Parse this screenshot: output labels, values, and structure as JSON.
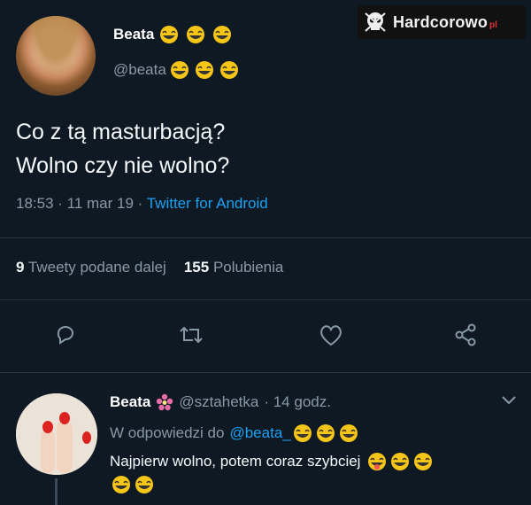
{
  "watermark": {
    "brand": "Hardcorowo",
    "tld": "pl"
  },
  "tweet": {
    "display_name": "Beata",
    "handle": "@beata",
    "text_line1": "Co z tą masturbacją?",
    "text_line2": "Wolno czy nie wolno?",
    "time": "18:53 · 11 mar 19 · ",
    "source": "Twitter for Android",
    "retweets_count": "9",
    "retweets_label": "Tweety podane dalej",
    "likes_count": "155",
    "likes_label": "Polubienia"
  },
  "actions": [
    "reply-icon",
    "retweet-icon",
    "like-icon",
    "share-icon"
  ],
  "reply": {
    "display_name": "Beata",
    "handle": "@sztahetka",
    "time": "· 14 godz.",
    "reply_to_label": "W odpowiedzi do",
    "reply_to_mention": "@beata_",
    "text": "Najpierw wolno,  potem coraz szybciej"
  },
  "colors": {
    "background": "#0f1923",
    "link": "#1da1f2",
    "muted": "#8899a6"
  }
}
